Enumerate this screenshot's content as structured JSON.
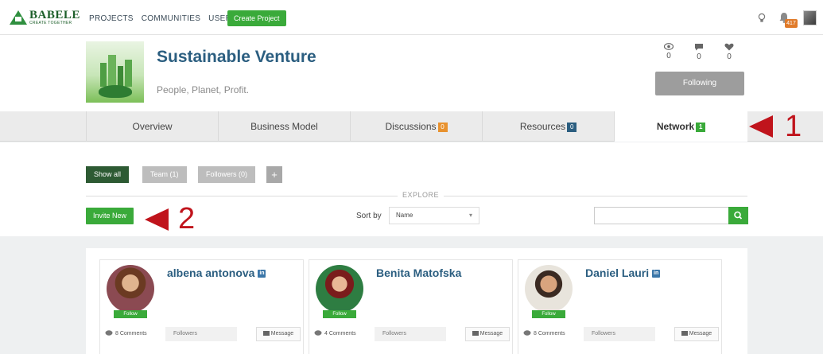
{
  "topbar": {
    "logo_name": "BABELE",
    "logo_tagline": "CREATE TOGETHER",
    "nav": [
      "PROJECTS",
      "COMMUNITIES",
      "USERS"
    ],
    "create_label": "Create Project",
    "notifications_count": "417",
    "icons": [
      "lightbulb-icon",
      "bell-icon"
    ]
  },
  "project": {
    "title": "Sustainable Venture",
    "tagline": "People, Planet, Profit.",
    "stats": {
      "views": "0",
      "comments": "0",
      "likes": "0"
    },
    "following_label": "Following"
  },
  "tabs": [
    {
      "label": "Overview",
      "badge": ""
    },
    {
      "label": "Business Model",
      "badge": ""
    },
    {
      "label": "Discussions",
      "badge": "0",
      "badge_color": "#e8922f"
    },
    {
      "label": "Resources",
      "badge": "0",
      "badge_color": "#2b5e80"
    },
    {
      "label": "Network",
      "badge": "1",
      "badge_color": "#3aaa3a"
    }
  ],
  "annotations": {
    "one": "1",
    "two": "2"
  },
  "filters": {
    "show_all": "Show all",
    "team": "Team (1)",
    "followers": "Followers (0)",
    "add": "+",
    "explore": "EXPLORE",
    "invite": "Invite New",
    "sort_label": "Sort by",
    "sort_value": "Name",
    "search_placeholder": ""
  },
  "members": [
    {
      "name": "albena antonova",
      "linkedin": true,
      "comments": "8 Comments",
      "followers": "Followers",
      "message": "Message",
      "follow": "Follow"
    },
    {
      "name": "Benita Matofska",
      "linkedin": false,
      "comments": "4 Comments",
      "followers": "Followers",
      "message": "Message",
      "follow": "Follow"
    },
    {
      "name": "Daniel Lauri",
      "linkedin": true,
      "comments": "8 Comments",
      "followers": "Followers",
      "message": "Message",
      "follow": "Follow"
    }
  ],
  "colors": {
    "brand_green": "#3aaa3a",
    "title_blue": "#2b5e80",
    "annotation_red": "#c0141c"
  }
}
